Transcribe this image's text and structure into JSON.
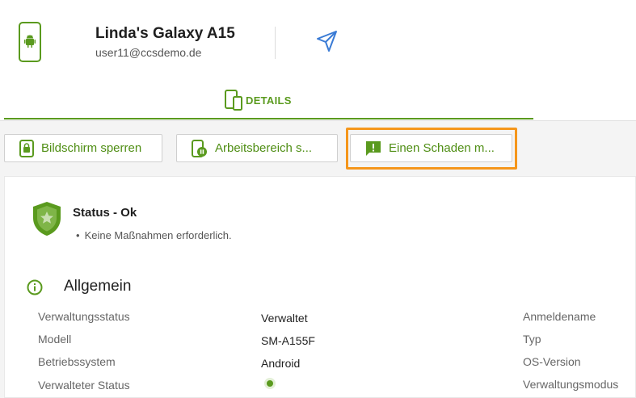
{
  "header": {
    "device_name": "Linda's Galaxy A15",
    "email": "user11@ccsdemo.de"
  },
  "tabs": [
    {
      "label": "DETAILS",
      "active": true
    }
  ],
  "actions": [
    {
      "label": "Bildschirm sperren",
      "icon": "lock-phone-icon"
    },
    {
      "label": "Arbeitsbereich s...",
      "icon": "pause-phone-icon"
    },
    {
      "label": "Einen Schaden m...",
      "icon": "report-message-icon",
      "highlighted": true
    }
  ],
  "status": {
    "title": "Status - Ok",
    "note": "Keine Maßnahmen erforderlich."
  },
  "section": {
    "title": "Allgemein",
    "rows": [
      {
        "label": "Verwaltungsstatus",
        "value": "Verwaltet"
      },
      {
        "label": "Modell",
        "value": "SM-A155F"
      },
      {
        "label": "Betriebssystem",
        "value": "Android"
      },
      {
        "label": "Verwalteter Status",
        "value": ""
      }
    ],
    "right_labels": [
      "Anmeldename",
      "Typ",
      "OS-Version",
      "Verwaltungsmodus"
    ]
  },
  "colors": {
    "accent": "#5a9a1e",
    "highlight": "#f5961b"
  }
}
